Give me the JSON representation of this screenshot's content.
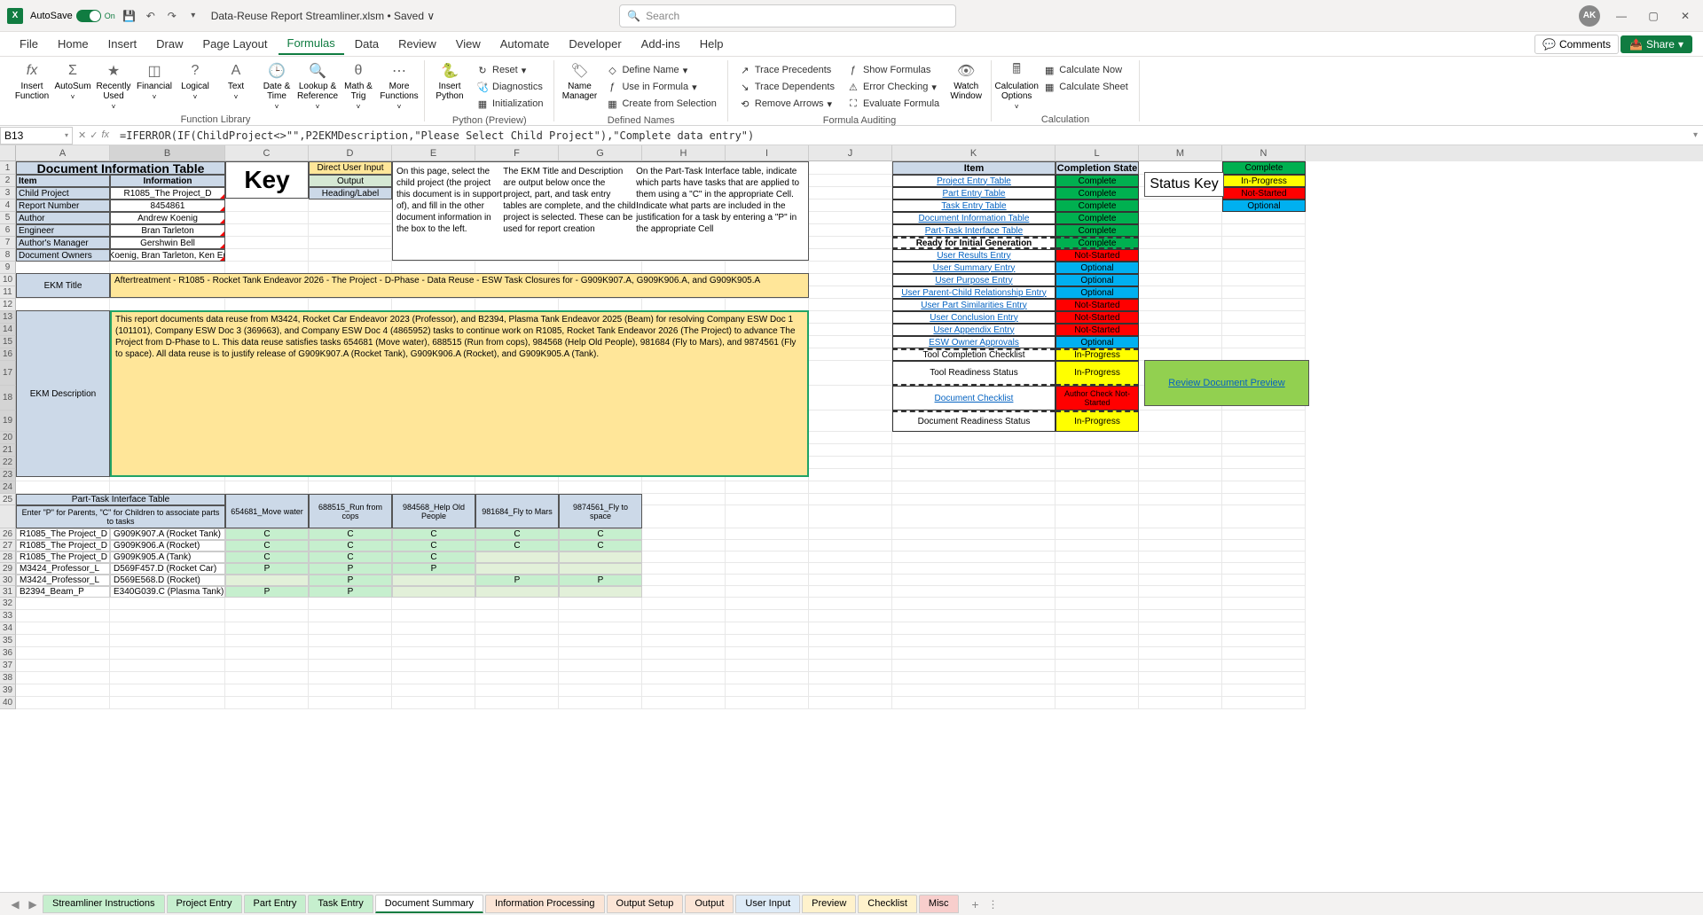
{
  "titlebar": {
    "autosave_label": "AutoSave",
    "autosave_state": "On",
    "filename": "Data-Reuse Report Streamliner.xlsm • Saved ∨",
    "search_placeholder": "Search",
    "avatar": "AK"
  },
  "ribbon": {
    "tabs": [
      "File",
      "Home",
      "Insert",
      "Draw",
      "Page Layout",
      "Formulas",
      "Data",
      "Review",
      "View",
      "Automate",
      "Developer",
      "Add-ins",
      "Help"
    ],
    "active_tab": "Formulas",
    "comments": "Comments",
    "share": "Share",
    "groups": {
      "function_library": {
        "label": "Function Library",
        "insert_function": "Insert Function",
        "autosum": "AutoSum",
        "recently": "Recently Used",
        "financial": "Financial",
        "logical": "Logical",
        "text": "Text",
        "date_time": "Date & Time",
        "lookup": "Lookup & Reference",
        "math_trig": "Math & Trig",
        "more": "More Functions"
      },
      "python": {
        "label": "Python (Preview)",
        "insert_python": "Insert Python",
        "reset": "Reset",
        "diagnostics": "Diagnostics",
        "initialization": "Initialization"
      },
      "defined_names": {
        "label": "Defined Names",
        "name_manager": "Name Manager",
        "define_name": "Define Name",
        "use_in_formula": "Use in Formula",
        "create_from_selection": "Create from Selection"
      },
      "formula_auditing": {
        "label": "Formula Auditing",
        "trace_precedents": "Trace Precedents",
        "trace_dependents": "Trace Dependents",
        "remove_arrows": "Remove Arrows",
        "show_formulas": "Show Formulas",
        "error_checking": "Error Checking",
        "evaluate_formula": "Evaluate Formula",
        "watch_window": "Watch Window"
      },
      "calculation": {
        "label": "Calculation",
        "options": "Calculation Options",
        "calc_now": "Calculate Now",
        "calc_sheet": "Calculate Sheet"
      }
    }
  },
  "formula_bar": {
    "name_box": "B13",
    "formula": "=IFERROR(IF(ChildProject<>\"\",P2EKMDescription,\"Please Select Child Project\"),\"Complete data entry\")"
  },
  "columns": [
    "A",
    "B",
    "C",
    "D",
    "E",
    "F",
    "G",
    "H",
    "I",
    "J",
    "K",
    "L",
    "M",
    "N"
  ],
  "doc_info": {
    "title": "Document Information Table",
    "hdr_item": "Item",
    "hdr_info": "Information",
    "rows": [
      {
        "item": "Child Project",
        "info": "R1085_The Project_D"
      },
      {
        "item": "Report Number",
        "info": "8454861"
      },
      {
        "item": "Author",
        "info": "Andrew Koenig"
      },
      {
        "item": "Engineer",
        "info": "Bran Tarleton"
      },
      {
        "item": "Author's Manager",
        "info": "Gershwin Bell"
      },
      {
        "item": "Document Owners",
        "info": "ew Koenig, Bran Tarleton, Ken Erdos"
      }
    ]
  },
  "key": {
    "label": "Key",
    "input": "Direct User Input",
    "output": "Output",
    "heading": "Heading/Label"
  },
  "instructions": {
    "p1": "On this page, select the child project (the project this document is in support of), and fill in the other document information in the box to the left.",
    "p2": "The EKM Title and Description are output below once the project, part, and task entry tables are complete, and the child project is selected. These can be used for report creation",
    "p3": "On the Part-Task Interface table, indicate which parts have tasks that are applied to them using a \"C\" in the appropriate Cell. Indicate what parts are included in the justification for a task by entering a \"P\" in the appropriate Cell"
  },
  "ekm": {
    "title_label": "EKM Title",
    "title_value": "Aftertreatment - R1085 - Rocket Tank Endeavor 2026 - The Project - D-Phase - Data Reuse - ESW Task Closures for - G909K907.A, G909K906.A, and G909K905.A",
    "desc_label": "EKM Description",
    "desc_value": "This report documents data reuse from M3424, Rocket Car Endeavor 2023 (Professor), and B2394, Plasma Tank Endeavor 2025 (Beam) for resolving Company ESW Doc 1 (101101), Company ESW Doc 3 (369663), and Company ESW Doc 4 (4865952) tasks to continue work on R1085, Rocket Tank Endeavor 2026 (The Project) to advance The Project from D-Phase to L. This data reuse satisfies tasks 654681 (Move water), 688515 (Run from cops), 984568 (Help Old People), 981684 (Fly to Mars), and 9874561 (Fly to space). All data reuse is to justify release of G909K907.A (Rocket Tank), G909K906.A (Rocket), and G909K905.A (Tank)."
  },
  "status": {
    "key_label": "Status Key",
    "hdr_item": "Item",
    "hdr_state": "Completion State",
    "legend": [
      "Complete",
      "In-Progress",
      "Not-Started",
      "Optional"
    ],
    "rows": [
      {
        "item": "Project Entry Table",
        "link": true,
        "state": "Complete",
        "cls": "status-complete",
        "dashed": false
      },
      {
        "item": "Part Entry Table",
        "link": true,
        "state": "Complete",
        "cls": "status-complete",
        "dashed": false
      },
      {
        "item": "Task Entry Table",
        "link": true,
        "state": "Complete",
        "cls": "status-complete",
        "dashed": false
      },
      {
        "item": "Document Information Table",
        "link": true,
        "state": "Complete",
        "cls": "status-complete",
        "dashed": false
      },
      {
        "item": "Part-Task Interface Table",
        "link": true,
        "state": "Complete",
        "cls": "status-complete",
        "dashed": false
      },
      {
        "item": "Ready for Initial Generation",
        "link": false,
        "state": "Complete",
        "cls": "status-complete",
        "dashed": true,
        "bold": true
      },
      {
        "item": "User Results Entry",
        "link": true,
        "state": "Not-Started",
        "cls": "status-notstarted",
        "dashed": false
      },
      {
        "item": "User Summary Entry",
        "link": true,
        "state": "Optional",
        "cls": "status-optional",
        "dashed": false
      },
      {
        "item": "User Purpose Entry",
        "link": true,
        "state": "Optional",
        "cls": "status-optional",
        "dashed": false
      },
      {
        "item": "User Parent-Child Relationship Entry",
        "link": true,
        "state": "Optional",
        "cls": "status-optional",
        "dashed": false
      },
      {
        "item": "User Part Similarities Entry",
        "link": true,
        "state": "Not-Started",
        "cls": "status-notstarted",
        "dashed": false
      },
      {
        "item": "User Conclusion Entry",
        "link": true,
        "state": "Not-Started",
        "cls": "status-notstarted",
        "dashed": false
      },
      {
        "item": "User Appendix Entry",
        "link": true,
        "state": "Not-Started",
        "cls": "status-notstarted",
        "dashed": false
      },
      {
        "item": "ESW Owner Approvals",
        "link": true,
        "state": "Optional",
        "cls": "status-optional",
        "dashed": false
      },
      {
        "item": "Tool Completion Checklist",
        "link": false,
        "state": "In-Progress",
        "cls": "status-progress",
        "dashed": true
      }
    ],
    "tool_readiness": {
      "item": "Tool Readiness Status",
      "state": "In-Progress",
      "cls": "status-progress"
    },
    "doc_checklist": {
      "item": "Document Checklist",
      "state": "Author Check Not-Started",
      "cls": "status-notstarted"
    },
    "doc_readiness": {
      "item": "Document Readiness Status",
      "state": "In-Progress",
      "cls": "status-progress"
    },
    "review_link": "Review Document Preview"
  },
  "part_task": {
    "title": "Part-Task Interface Table",
    "instr": "Enter \"P\" for Parents, \"C\" for Children to associate parts to tasks",
    "tasks": [
      "654681_Move water",
      "688515_Run from cops",
      "984568_Help Old People",
      "981684_Fly to Mars",
      "9874561_Fly to space"
    ],
    "rows": [
      {
        "proj": "R1085_The Project_D",
        "part": "G909K907.A (Rocket Tank)",
        "v": [
          "C",
          "C",
          "C",
          "C",
          "C"
        ]
      },
      {
        "proj": "R1085_The Project_D",
        "part": "G909K906.A (Rocket)",
        "v": [
          "C",
          "C",
          "C",
          "C",
          "C"
        ]
      },
      {
        "proj": "R1085_The Project_D",
        "part": "G909K905.A (Tank)",
        "v": [
          "C",
          "C",
          "C",
          "",
          ""
        ]
      },
      {
        "proj": "M3424_Professor_L",
        "part": "D569F457.D (Rocket Car)",
        "v": [
          "P",
          "P",
          "P",
          "",
          ""
        ]
      },
      {
        "proj": "M3424_Professor_L",
        "part": "D569E568.D (Rocket)",
        "v": [
          "",
          "P",
          "",
          "P",
          "P"
        ]
      },
      {
        "proj": "B2394_Beam_P",
        "part": "E340G039.C (Plasma Tank)",
        "v": [
          "P",
          "P",
          "",
          "",
          ""
        ]
      }
    ]
  },
  "sheet_tabs": [
    {
      "name": "Streamliner Instructions",
      "cls": "st-green"
    },
    {
      "name": "Project Entry",
      "cls": "st-green"
    },
    {
      "name": "Part Entry",
      "cls": "st-green"
    },
    {
      "name": "Task Entry",
      "cls": "st-green"
    },
    {
      "name": "Document Summary",
      "cls": "active"
    },
    {
      "name": "Information Processing",
      "cls": "st-orange"
    },
    {
      "name": "Output Setup",
      "cls": "st-orange"
    },
    {
      "name": "Output",
      "cls": "st-orange"
    },
    {
      "name": "User Input",
      "cls": "st-blue"
    },
    {
      "name": "Preview",
      "cls": "st-yellow"
    },
    {
      "name": "Checklist",
      "cls": "st-yellow"
    },
    {
      "name": "Misc",
      "cls": "st-red"
    }
  ]
}
